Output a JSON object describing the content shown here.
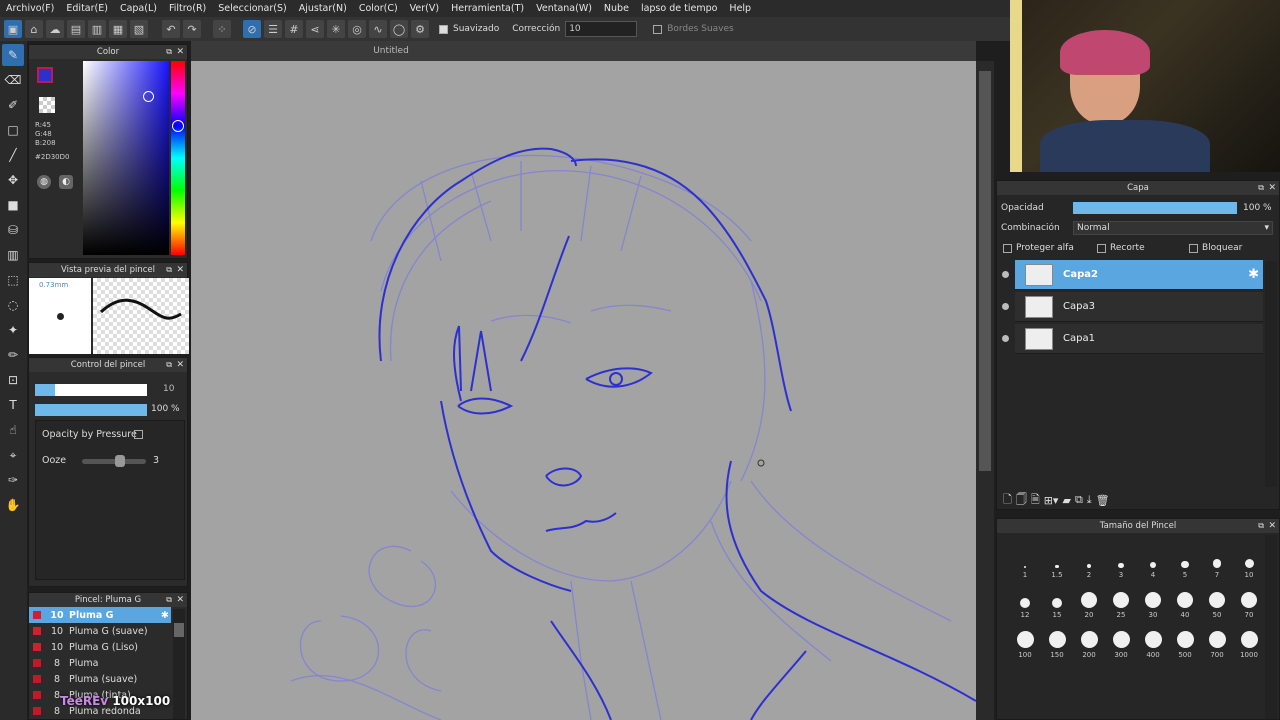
{
  "menu": [
    "Archivo(F)",
    "Editar(E)",
    "Capa(L)",
    "Filtro(R)",
    "Seleccionar(S)",
    "Ajustar(N)",
    "Color(C)",
    "Ver(V)",
    "Herramienta(T)",
    "Ventana(W)",
    "Nube",
    "lapso de tiempo",
    "Help"
  ],
  "toolbar": {
    "smooth_label": "Suavizado",
    "correction_label": "Corrección",
    "correction_value": "10",
    "soft_edges_label": "Bordes Suaves"
  },
  "canvas": {
    "title": "Untitled"
  },
  "color_panel": {
    "title": "Color",
    "r": "R:45",
    "g": "G:48",
    "b": "B:208",
    "hex": "#2D30D0",
    "accent": "#2D30D0"
  },
  "brush_preview": {
    "title": "Vista previa del pincel",
    "size": "0.73mm"
  },
  "brush_control": {
    "title": "Control del pincel",
    "size_value": "10",
    "opacity_value": "100 %",
    "opacity_by_pressure": "Opacity by Pressure",
    "ooze_label": "Ooze",
    "ooze_value": "3"
  },
  "brush_list": {
    "title": "Pincel: Pluma G",
    "items": [
      {
        "size": "10",
        "name": "Pluma G",
        "selected": true
      },
      {
        "size": "10",
        "name": "Pluma G (suave)",
        "selected": false
      },
      {
        "size": "10",
        "name": "Pluma G (Liso)",
        "selected": false
      },
      {
        "size": "8",
        "name": "Pluma",
        "selected": false
      },
      {
        "size": "8",
        "name": "Pluma (suave)",
        "selected": false
      },
      {
        "size": "8",
        "name": "Pluma (tinta)",
        "selected": false
      },
      {
        "size": "8",
        "name": "Pluma redonda",
        "selected": false
      }
    ]
  },
  "overlay": {
    "handle": "TeeREv",
    "size": "100x100"
  },
  "layer_panel": {
    "title": "Capa",
    "opacity_label": "Opacidad",
    "opacity_value": "100 %",
    "opacity_fraction": 1.0,
    "blend_label": "Combinación",
    "blend_value": "Normal",
    "protect_alpha": "Proteger alfa",
    "clipping": "Recorte",
    "lock": "Bloquear",
    "layers": [
      {
        "name": "Capa2",
        "selected": true
      },
      {
        "name": "Capa3",
        "selected": false
      },
      {
        "name": "Capa1",
        "selected": false
      }
    ]
  },
  "brush_size_panel": {
    "title": "Tamaño del Pincel",
    "sizes": [
      "1",
      "1.5",
      "2",
      "3",
      "4",
      "5",
      "7",
      "10",
      "12",
      "15",
      "20",
      "25",
      "30",
      "40",
      "50",
      "70",
      "100",
      "150",
      "200",
      "300",
      "400",
      "500",
      "700",
      "1000"
    ]
  }
}
